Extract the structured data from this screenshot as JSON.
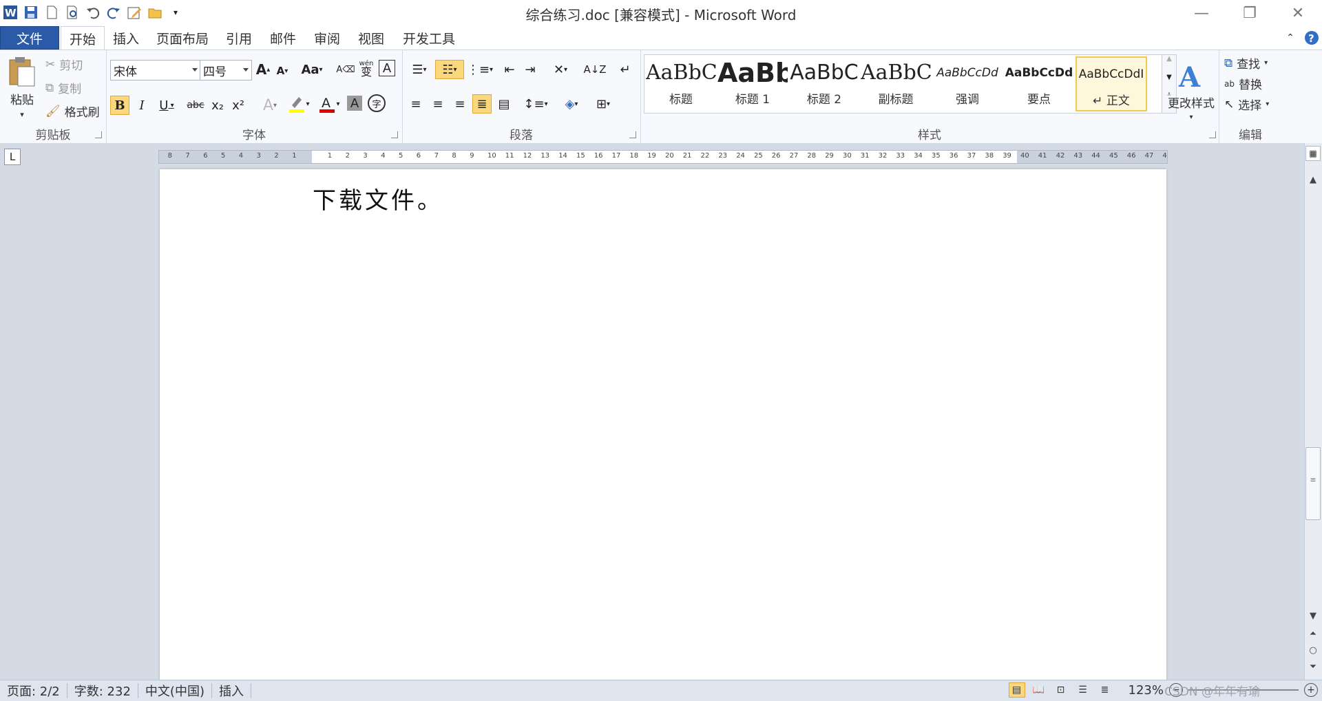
{
  "window": {
    "title": "综合练习.doc [兼容模式] - Microsoft Word",
    "minimize_glyph": "—",
    "restore_glyph": "❐",
    "close_glyph": "✕"
  },
  "qat": {
    "icons": [
      "word-icon",
      "save-icon",
      "new-icon",
      "print-preview-icon",
      "undo-icon",
      "redo-icon",
      "edit-icon",
      "open-icon",
      "customize-icon"
    ]
  },
  "tabs": [
    "文件",
    "开始",
    "插入",
    "页面布局",
    "引用",
    "邮件",
    "审阅",
    "视图",
    "开发工具"
  ],
  "clipboard": {
    "label": "剪贴板",
    "paste": "粘贴",
    "cut": "剪切",
    "copy": "复制",
    "format_painter": "格式刷"
  },
  "font": {
    "label": "字体",
    "font_name": "宋体",
    "font_size": "四号",
    "bold": "B",
    "italic": "I",
    "underline": "U",
    "strike": "abc",
    "subscript": "x₂",
    "superscript": "x²",
    "grow": "A",
    "shrink": "A",
    "case": "Aa",
    "char_border": "A",
    "phonetic": "wén",
    "phonetic_char": "变",
    "enclose": "字"
  },
  "paragraph": {
    "label": "段落"
  },
  "styles": {
    "label": "样式",
    "items": [
      {
        "sample": "AaBbC",
        "name": "标题"
      },
      {
        "sample": "AaBb",
        "name": "标题 1"
      },
      {
        "sample": "AaBbC",
        "name": "标题 2"
      },
      {
        "sample": "AaBbC",
        "name": "副标题"
      },
      {
        "sample": "AaBbCcDd",
        "name": "强调"
      },
      {
        "sample": "AaBbCcDd",
        "name": "要点"
      },
      {
        "sample": "AaBbCcDdI",
        "name": "↵ 正文"
      }
    ],
    "change_styles": "更改样式"
  },
  "editing": {
    "label": "编辑",
    "find": "查找",
    "replace": "替换",
    "select": "选择"
  },
  "document": {
    "text": "下载文件。"
  },
  "status": {
    "page": "页面: 2/2",
    "words": "字数: 232",
    "language": "中文(中国)",
    "mode": "插入",
    "zoom": "123%",
    "watermark": "CSDN @年年有瑜"
  }
}
